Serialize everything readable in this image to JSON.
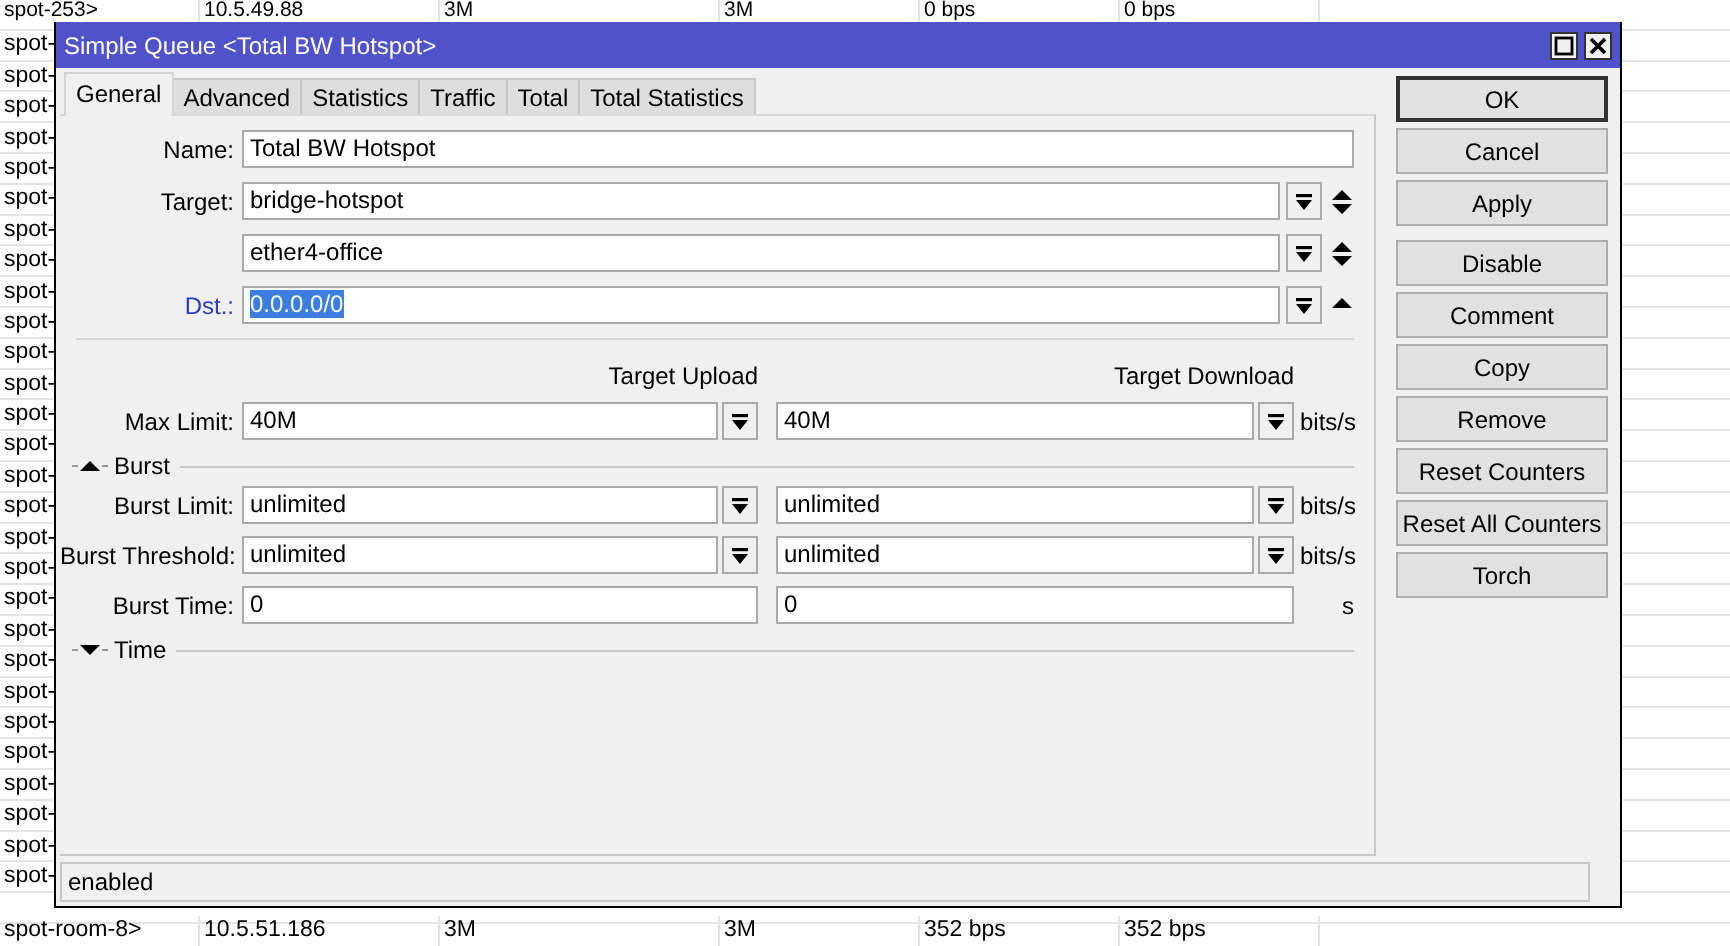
{
  "list": {
    "top_rows": [
      {
        "cells": [
          "spot-253>",
          "10.5.49.88",
          "3M",
          "3M",
          "0 bps",
          "0 bps"
        ]
      },
      {
        "cells": [
          "spot-"
        ]
      },
      {
        "cells": [
          "spot-"
        ]
      },
      {
        "cells": [
          "spot-"
        ]
      },
      {
        "cells": [
          "spot-"
        ]
      },
      {
        "cells": [
          "spot-"
        ]
      },
      {
        "cells": [
          "spot-"
        ]
      },
      {
        "cells": [
          "spot-"
        ]
      },
      {
        "cells": [
          "spot-"
        ]
      },
      {
        "cells": [
          "spot-"
        ]
      },
      {
        "cells": [
          "spot-"
        ]
      },
      {
        "cells": [
          "spot-"
        ]
      },
      {
        "cells": [
          "spot-"
        ]
      },
      {
        "cells": [
          "spot-"
        ]
      },
      {
        "cells": [
          "spot-"
        ]
      },
      {
        "cells": [
          "spot-"
        ]
      },
      {
        "cells": [
          "spot-"
        ]
      },
      {
        "cells": [
          "spot-"
        ]
      },
      {
        "cells": [
          "spot-"
        ]
      },
      {
        "cells": [
          "spot-"
        ]
      },
      {
        "cells": [
          "spot-"
        ]
      },
      {
        "cells": [
          "spot-"
        ]
      },
      {
        "cells": [
          "spot-"
        ]
      },
      {
        "cells": [
          "spot-"
        ]
      },
      {
        "cells": [
          "spot-"
        ]
      },
      {
        "cells": [
          "spot-"
        ]
      },
      {
        "cells": [
          "spot-"
        ]
      },
      {
        "cells": [
          "spot-"
        ]
      },
      {
        "cells": [
          "spot-"
        ]
      }
    ],
    "bottom_row": {
      "cells": [
        "spot-room-8>",
        "10.5.51.186",
        "3M",
        "3M",
        "352 bps",
        "352 bps"
      ]
    }
  },
  "window": {
    "title": "Simple Queue <Total BW Hotspot>"
  },
  "tabs": [
    {
      "label": "General",
      "selected": true
    },
    {
      "label": "Advanced",
      "selected": false
    },
    {
      "label": "Statistics",
      "selected": false
    },
    {
      "label": "Traffic",
      "selected": false
    },
    {
      "label": "Total",
      "selected": false
    },
    {
      "label": "Total Statistics",
      "selected": false
    }
  ],
  "fields": [
    {
      "kind": "text",
      "label": "Name:",
      "value": "Total BW Hotspot",
      "changed": false,
      "value_selected": false
    },
    {
      "kind": "list",
      "label": "Target:",
      "value": "bridge-hotspot",
      "up_arrow": true,
      "down_arrow": true,
      "changed": false,
      "value_selected": false
    },
    {
      "kind": "list",
      "value": "ether4-office",
      "up_arrow": true,
      "down_arrow": true,
      "value_selected": false
    },
    {
      "kind": "list",
      "label": "Dst.:",
      "value": "0.0.0.0/0",
      "up_arrow": true,
      "down_arrow": false,
      "changed": true,
      "value_selected": true
    }
  ],
  "limit_headers": [
    "Target Upload",
    "Target Download"
  ],
  "limits": [
    {
      "kind": "dropdown",
      "label": "Max Limit:",
      "upload": "40M",
      "download": "40M",
      "unit": "bits/s"
    }
  ],
  "sections": [
    {
      "label": "Burst",
      "expanded": true,
      "rows": [
        {
          "kind": "dropdown",
          "label": "Burst Limit:",
          "upload": "unlimited",
          "download": "unlimited",
          "unit": "bits/s"
        },
        {
          "kind": "dropdown",
          "label": "Burst Threshold:",
          "upload": "unlimited",
          "download": "unlimited",
          "unit": "bits/s"
        },
        {
          "kind": "plain",
          "label": "Burst Time:",
          "upload": "0",
          "download": "0",
          "unit": "s"
        }
      ]
    },
    {
      "label": "Time",
      "expanded": false
    }
  ],
  "button_groups": [
    {
      "buttons": [
        {
          "label": "OK",
          "default": true
        },
        {
          "label": "Cancel",
          "default": false
        },
        {
          "label": "Apply",
          "default": false
        }
      ]
    },
    {
      "buttons": [
        {
          "label": "Disable",
          "default": false
        },
        {
          "label": "Comment",
          "default": false
        },
        {
          "label": "Copy",
          "default": false
        },
        {
          "label": "Remove",
          "default": false
        },
        {
          "label": "Reset Counters",
          "default": false
        },
        {
          "label": "Reset All Counters",
          "default": false
        },
        {
          "label": "Torch",
          "default": false
        }
      ]
    }
  ],
  "status_bar": "enabled"
}
